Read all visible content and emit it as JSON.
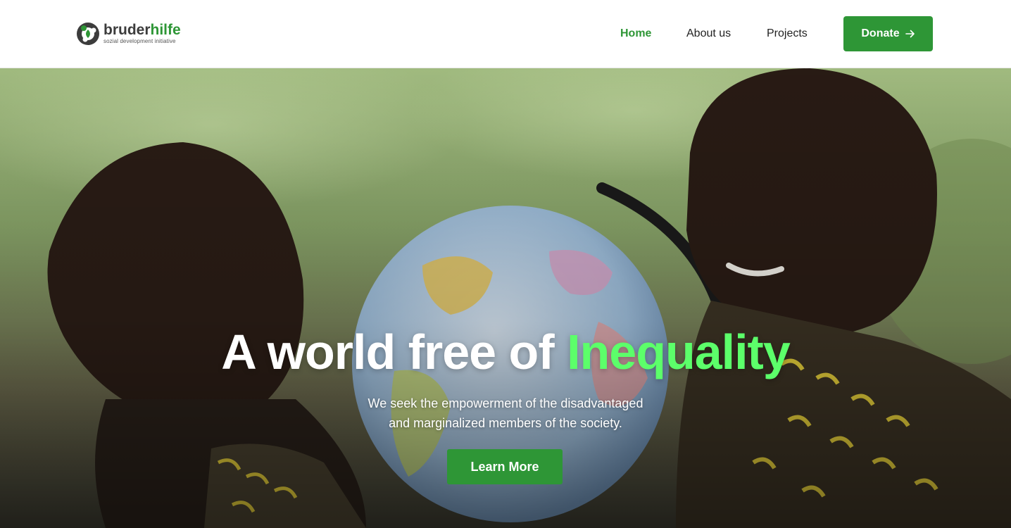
{
  "header": {
    "logo": {
      "word_main": "bruder",
      "word_accent": "hilfe",
      "tagline": "sozial development initiative"
    },
    "nav": [
      {
        "label": "Home",
        "active": true
      },
      {
        "label": "About us",
        "active": false
      },
      {
        "label": "Projects",
        "active": false
      }
    ],
    "donate_label": "Donate",
    "donate_icon": "arrow-right-icon"
  },
  "hero": {
    "headline_main": "A world free of",
    "headline_highlight": "Inequality",
    "subtext_line1": "We seek the empowerment of the disadvantaged",
    "subtext_line2": "and marginalized members of the society.",
    "cta_label": "Learn More"
  },
  "colors": {
    "brand_green": "#2e9636",
    "highlight_green": "#5cff6a",
    "text_dark": "#222222"
  }
}
